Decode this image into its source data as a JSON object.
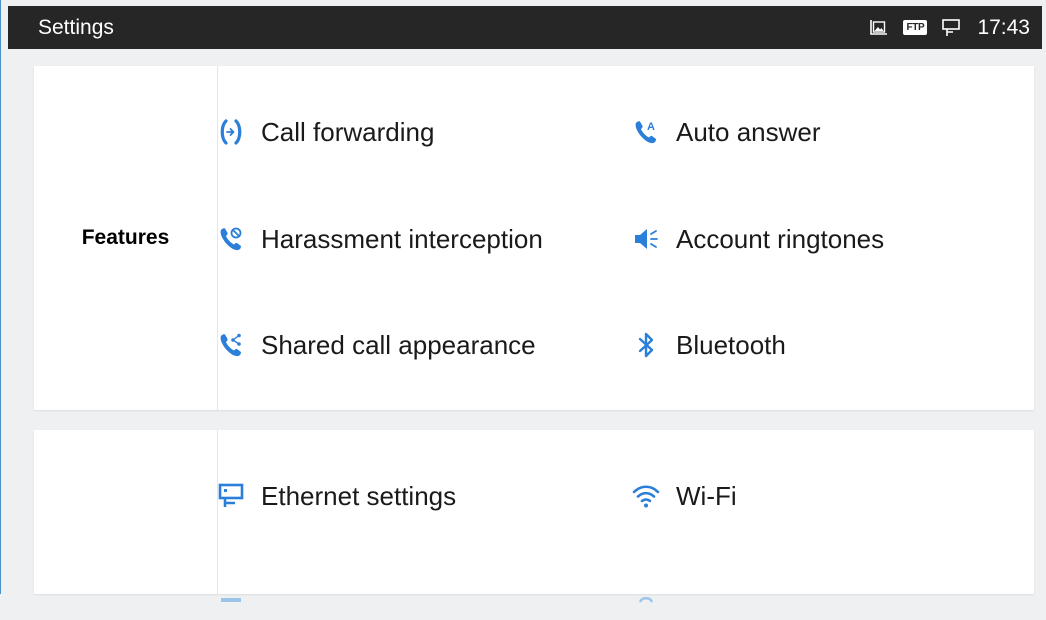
{
  "statusbar": {
    "title": "Settings",
    "ftp_badge": "FTP",
    "clock": "17:43"
  },
  "colors": {
    "accent": "#2b7fd8",
    "statusbar_bg": "#262626"
  },
  "sections": [
    {
      "label": "Features",
      "items": [
        {
          "label": "Call forwarding",
          "icon": "call-forwarding-icon"
        },
        {
          "label": "Auto answer",
          "icon": "auto-answer-icon"
        },
        {
          "label": "Harassment interception",
          "icon": "harassment-interception-icon"
        },
        {
          "label": "Account ringtones",
          "icon": "speaker-icon"
        },
        {
          "label": "Shared call appearance",
          "icon": "shared-call-icon"
        },
        {
          "label": "Bluetooth",
          "icon": "bluetooth-icon"
        }
      ]
    },
    {
      "label": "",
      "items": [
        {
          "label": "Ethernet settings",
          "icon": "ethernet-icon"
        },
        {
          "label": "Wi-Fi",
          "icon": "wifi-icon"
        }
      ]
    }
  ]
}
